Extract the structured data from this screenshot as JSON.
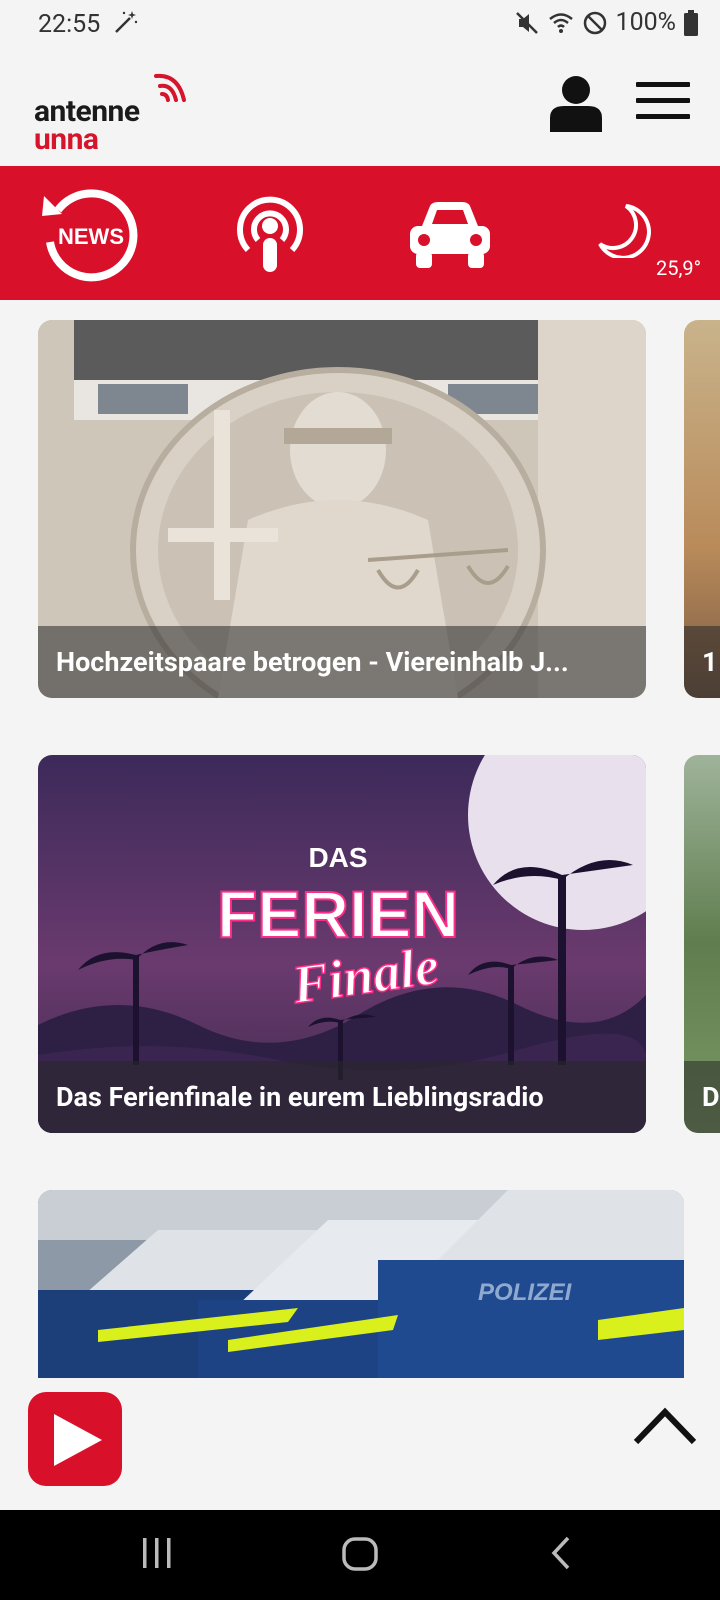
{
  "status_bar": {
    "time": "22:55",
    "battery": "100%",
    "icons": [
      "magic-wand-icon",
      "mute-icon",
      "wifi-icon",
      "do-not-disturb-icon",
      "battery-icon"
    ]
  },
  "header": {
    "logo_line1": "antenne",
    "logo_line2": "unna",
    "icons": [
      "user-icon",
      "menu-icon"
    ]
  },
  "shortcut_bar": {
    "news_label": "NEWS",
    "temperature": "25,9°",
    "icons": [
      "news-icon",
      "podcast-icon",
      "car-icon",
      "moon-icon"
    ],
    "color": "#d9102a"
  },
  "cards": [
    {
      "caption": "Hochzeitspaare betrogen - Viereinhalb J..."
    },
    {
      "caption": "1"
    },
    {
      "caption": "Das Ferienfinale in eurem Lieblingsradio"
    },
    {
      "caption": "D"
    }
  ],
  "promo": {
    "line1": "DAS",
    "line2": "FERIEN",
    "line3": "Finale"
  },
  "police_text": "POLIZEI",
  "player": {
    "icons": [
      "play-icon",
      "chevron-up-icon"
    ]
  },
  "nav": {
    "icons": [
      "recent-apps-icon",
      "home-icon",
      "back-icon"
    ]
  }
}
